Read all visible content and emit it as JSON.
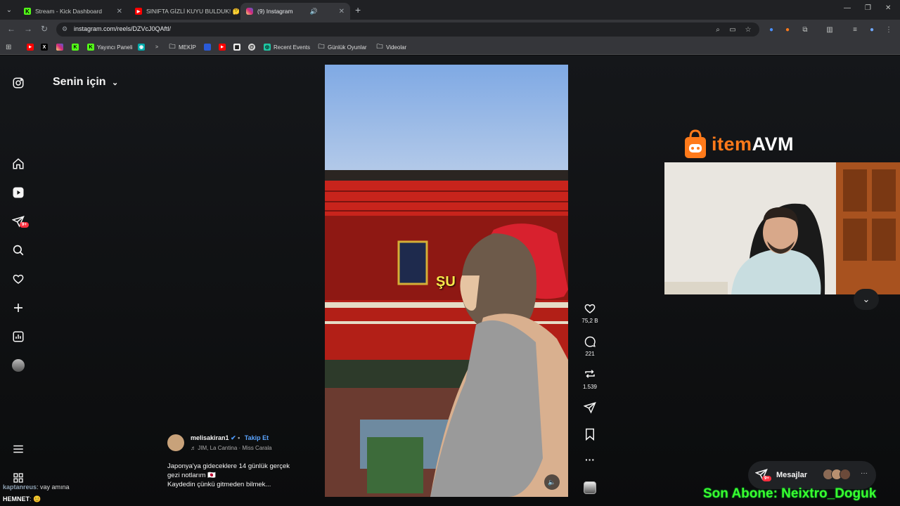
{
  "browser": {
    "tabs": [
      {
        "title": "Stream - Kick Dashboard",
        "favicon_color": "#53fc18",
        "favicon_glyph": "K"
      },
      {
        "title": "SINIFTA GİZLİ KUYU BULDUK! 🤔",
        "favicon_color": "#ff0000",
        "favicon_glyph": "▶"
      },
      {
        "title": "(9) Instagram",
        "favicon_color": "#e1306c",
        "favicon_glyph": "◎"
      }
    ],
    "url": "instagram.com/reels/DZVcJ0QAftl/",
    "bookmarks": [
      {
        "label": "Yayıncı Paneli",
        "icon": "kick-icon"
      },
      {
        "label": "MEKİP",
        "icon": "folder-icon"
      },
      {
        "label": "Recent Events",
        "icon": "recent-events-icon"
      },
      {
        "label": "Günlük Oyunlar",
        "icon": "folder-icon"
      },
      {
        "label": "Videolar",
        "icon": "folder-icon"
      }
    ]
  },
  "instagram": {
    "feed_title": "Senin için",
    "notification_badge": "9+",
    "reel": {
      "overlay_text": "ŞU",
      "author": "melisakiran1",
      "follow_label": "Takip Et",
      "music": "JIM, La Cantina · Miss Carala",
      "description_line1": "Japonya'ya gideceklere 14 günlük gerçek",
      "description_line2": "gezi notlarım 🇯🇵",
      "description_line3": "Kaydedin çünkü gitmeden bilmek..."
    },
    "actions": {
      "likes": "75,2 B",
      "comments": "221",
      "reposts": "1.539"
    },
    "messages_label": "Mesajlar",
    "messages_badge": "9+"
  },
  "stream_overlay": {
    "sponsor_logo_prefix": "item",
    "sponsor_logo_suffix": "AVM",
    "latest_sub_text": "Son Abone: Neixtro_Doguk",
    "chat": [
      {
        "user": "kaptanreus",
        "message": ": vay amına"
      },
      {
        "user": "HEMNET",
        "message": ": 😊"
      }
    ]
  },
  "colors": {
    "accent_blue": "#5aa4ff",
    "notification_red": "#ff3040",
    "sub_green": "#3aff2e",
    "item_orange": "#ff7a1a"
  }
}
